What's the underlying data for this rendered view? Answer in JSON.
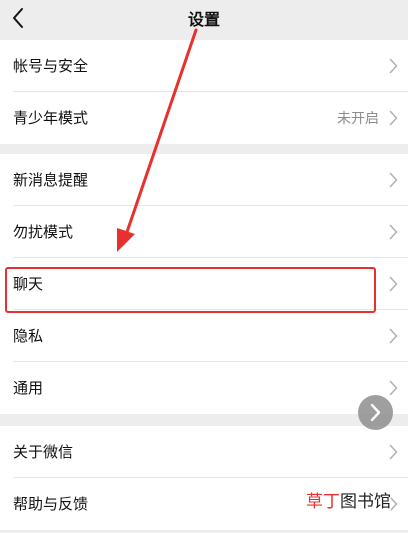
{
  "header": {
    "title": "设置",
    "back_icon": "chevron-left-icon"
  },
  "groups": [
    {
      "items": [
        {
          "label": "帐号与安全",
          "value": ""
        },
        {
          "label": "青少年模式",
          "value": "未开启"
        }
      ]
    },
    {
      "items": [
        {
          "label": "新消息提醒",
          "value": ""
        },
        {
          "label": "勿扰模式",
          "value": ""
        },
        {
          "label": "聊天",
          "value": "",
          "highlighted": true
        },
        {
          "label": "隐私",
          "value": ""
        },
        {
          "label": "通用",
          "value": ""
        }
      ]
    },
    {
      "items": [
        {
          "label": "关于微信",
          "value": ""
        },
        {
          "label": "帮助与反馈",
          "value": ""
        }
      ]
    }
  ],
  "floating_button": {
    "icon": "chevron-right-icon"
  },
  "annotation": {
    "color": "#e8302f"
  },
  "watermark": {
    "part_a": "草丁",
    "part_b": "图书馆"
  },
  "colors": {
    "background": "#ededed",
    "row_background": "#ffffff",
    "secondary_text": "#8c8c8c",
    "annotation_red": "#e8302f"
  }
}
